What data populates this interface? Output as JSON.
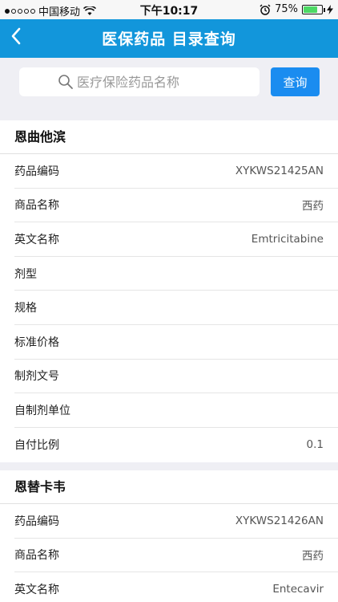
{
  "status_bar": {
    "carrier": "中国移动",
    "time": "下午10:17",
    "battery": "75%",
    "battery_level": 0.75
  },
  "nav": {
    "back_icon": "chevron-left-icon",
    "title": "医保药品 目录查询"
  },
  "search": {
    "placeholder": "医疗保险药品名称",
    "value": "",
    "button_label": "查询",
    "icon": "search-icon"
  },
  "drugs": [
    {
      "name": "恩曲他滨",
      "fields": [
        {
          "label": "药品编码",
          "value": "XYKWS21425AN"
        },
        {
          "label": "商品名称",
          "value": "西药"
        },
        {
          "label": "英文名称",
          "value": "Emtricitabine"
        },
        {
          "label": "剂型",
          "value": ""
        },
        {
          "label": "规格",
          "value": ""
        },
        {
          "label": "标准价格",
          "value": ""
        },
        {
          "label": "制剂文号",
          "value": ""
        },
        {
          "label": "自制剂单位",
          "value": ""
        },
        {
          "label": "自付比例",
          "value": "0.1"
        }
      ]
    },
    {
      "name": "恩替卡韦",
      "fields": [
        {
          "label": "药品编码",
          "value": "XYKWS21426AN"
        },
        {
          "label": "商品名称",
          "value": "西药"
        },
        {
          "label": "英文名称",
          "value": "Entecavir"
        }
      ]
    }
  ],
  "colors": {
    "nav_bg": "#1296db",
    "search_button": "#1a8cf0",
    "page_bg": "#efeff4"
  }
}
